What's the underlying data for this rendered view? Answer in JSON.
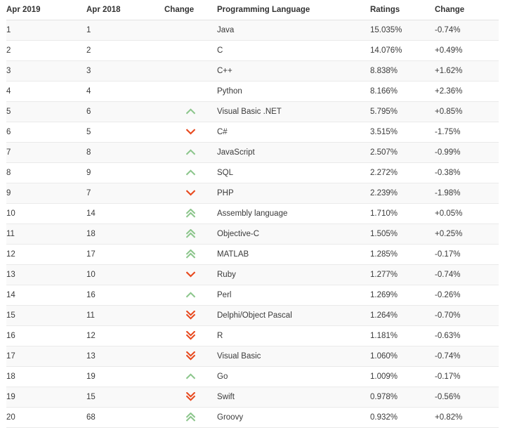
{
  "table": {
    "columns": [
      {
        "key": "rank_now",
        "label": "Apr 2019"
      },
      {
        "key": "rank_prev",
        "label": "Apr 2018"
      },
      {
        "key": "change_dir",
        "label": "Change"
      },
      {
        "key": "language",
        "label": "Programming Language"
      },
      {
        "key": "ratings",
        "label": "Ratings"
      },
      {
        "key": "change",
        "label": "Change"
      }
    ],
    "colors": {
      "up": "#8CC68C",
      "down": "#E8491E",
      "text": "#3a3a3a",
      "header_text": "#333333",
      "row_alt_bg": "#f9f9f9",
      "row_bg": "#ffffff",
      "border": "#eaeaea"
    },
    "rows": [
      {
        "rank_now": "1",
        "rank_prev": "1",
        "change_dir": "none",
        "change_icon": "",
        "language": "Java",
        "ratings": "15.035%",
        "change": "-0.74%"
      },
      {
        "rank_now": "2",
        "rank_prev": "2",
        "change_dir": "none",
        "change_icon": "",
        "language": "C",
        "ratings": "14.076%",
        "change": "+0.49%"
      },
      {
        "rank_now": "3",
        "rank_prev": "3",
        "change_dir": "none",
        "change_icon": "",
        "language": "C++",
        "ratings": "8.838%",
        "change": "+1.62%"
      },
      {
        "rank_now": "4",
        "rank_prev": "4",
        "change_dir": "none",
        "change_icon": "",
        "language": "Python",
        "ratings": "8.166%",
        "change": "+2.36%"
      },
      {
        "rank_now": "5",
        "rank_prev": "6",
        "change_dir": "up",
        "change_icon": "chevron-up-icon",
        "language": "Visual Basic .NET",
        "ratings": "5.795%",
        "change": "+0.85%"
      },
      {
        "rank_now": "6",
        "rank_prev": "5",
        "change_dir": "down",
        "change_icon": "chevron-down-icon",
        "language": "C#",
        "ratings": "3.515%",
        "change": "-1.75%"
      },
      {
        "rank_now": "7",
        "rank_prev": "8",
        "change_dir": "up",
        "change_icon": "chevron-up-icon",
        "language": "JavaScript",
        "ratings": "2.507%",
        "change": "-0.99%"
      },
      {
        "rank_now": "8",
        "rank_prev": "9",
        "change_dir": "up",
        "change_icon": "chevron-up-icon",
        "language": "SQL",
        "ratings": "2.272%",
        "change": "-0.38%"
      },
      {
        "rank_now": "9",
        "rank_prev": "7",
        "change_dir": "down",
        "change_icon": "chevron-down-icon",
        "language": "PHP",
        "ratings": "2.239%",
        "change": "-1.98%"
      },
      {
        "rank_now": "10",
        "rank_prev": "14",
        "change_dir": "double-up",
        "change_icon": "double-chevron-up-icon",
        "language": "Assembly language",
        "ratings": "1.710%",
        "change": "+0.05%"
      },
      {
        "rank_now": "11",
        "rank_prev": "18",
        "change_dir": "double-up",
        "change_icon": "double-chevron-up-icon",
        "language": "Objective-C",
        "ratings": "1.505%",
        "change": "+0.25%"
      },
      {
        "rank_now": "12",
        "rank_prev": "17",
        "change_dir": "double-up",
        "change_icon": "double-chevron-up-icon",
        "language": "MATLAB",
        "ratings": "1.285%",
        "change": "-0.17%"
      },
      {
        "rank_now": "13",
        "rank_prev": "10",
        "change_dir": "down",
        "change_icon": "chevron-down-icon",
        "language": "Ruby",
        "ratings": "1.277%",
        "change": "-0.74%"
      },
      {
        "rank_now": "14",
        "rank_prev": "16",
        "change_dir": "up",
        "change_icon": "chevron-up-icon",
        "language": "Perl",
        "ratings": "1.269%",
        "change": "-0.26%"
      },
      {
        "rank_now": "15",
        "rank_prev": "11",
        "change_dir": "double-down",
        "change_icon": "double-chevron-down-icon",
        "language": "Delphi/Object Pascal",
        "ratings": "1.264%",
        "change": "-0.70%"
      },
      {
        "rank_now": "16",
        "rank_prev": "12",
        "change_dir": "double-down",
        "change_icon": "double-chevron-down-icon",
        "language": "R",
        "ratings": "1.181%",
        "change": "-0.63%"
      },
      {
        "rank_now": "17",
        "rank_prev": "13",
        "change_dir": "double-down",
        "change_icon": "double-chevron-down-icon",
        "language": "Visual Basic",
        "ratings": "1.060%",
        "change": "-0.74%"
      },
      {
        "rank_now": "18",
        "rank_prev": "19",
        "change_dir": "up",
        "change_icon": "chevron-up-icon",
        "language": "Go",
        "ratings": "1.009%",
        "change": "-0.17%"
      },
      {
        "rank_now": "19",
        "rank_prev": "15",
        "change_dir": "double-down",
        "change_icon": "double-chevron-down-icon",
        "language": "Swift",
        "ratings": "0.978%",
        "change": "-0.56%"
      },
      {
        "rank_now": "20",
        "rank_prev": "68",
        "change_dir": "double-up",
        "change_icon": "double-chevron-up-icon",
        "language": "Groovy",
        "ratings": "0.932%",
        "change": "+0.82%"
      }
    ]
  }
}
